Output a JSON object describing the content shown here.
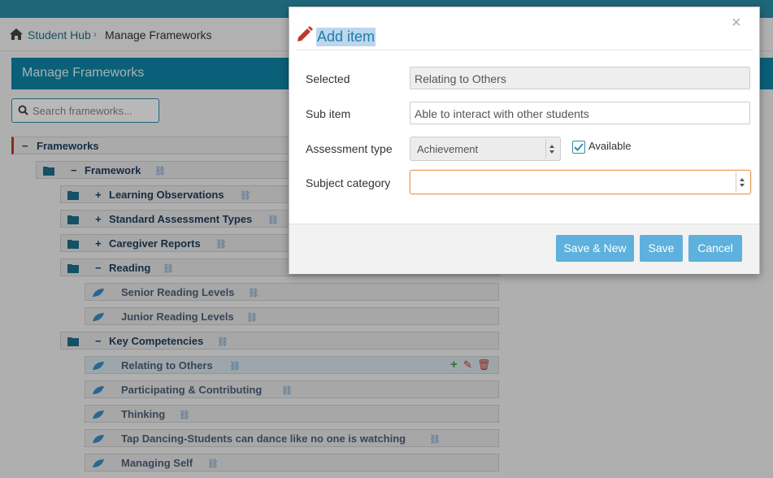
{
  "breadcrumb": {
    "home": "Student Hub",
    "current": "Manage Frameworks"
  },
  "panel": {
    "title": "Manage Frameworks"
  },
  "search": {
    "placeholder": "Search frameworks..."
  },
  "tree": {
    "root": "Frameworks",
    "framework": "Framework",
    "groups": [
      "Learning Observations",
      "Standard Assessment Types",
      "Caregiver Reports",
      "Reading"
    ],
    "reading_items": [
      "Senior Reading Levels",
      "Junior Reading Levels"
    ],
    "key_competencies": "Key Competencies",
    "kc_items": [
      "Relating to Others",
      "Participating & Contributing",
      "Thinking",
      "Tap Dancing-Students can dance like no one is watching",
      "Managing Self"
    ]
  },
  "modal": {
    "title": "Add item",
    "close": "×",
    "selected_label": "Selected",
    "selected_value": "Relating to Others",
    "subitem_label": "Sub item",
    "subitem_value": "Able to interact with other students",
    "assessment_label": "Assessment type",
    "assessment_value": "Achievement",
    "available_label": "Available",
    "available_checked": true,
    "subject_label": "Subject category",
    "subject_value": "",
    "buttons": {
      "save_new": "Save & New",
      "save": "Save",
      "cancel": "Cancel"
    }
  },
  "colors": {
    "accent": "#0f86a8",
    "button": "#5eb1dd",
    "link": "#1f6f8b"
  }
}
